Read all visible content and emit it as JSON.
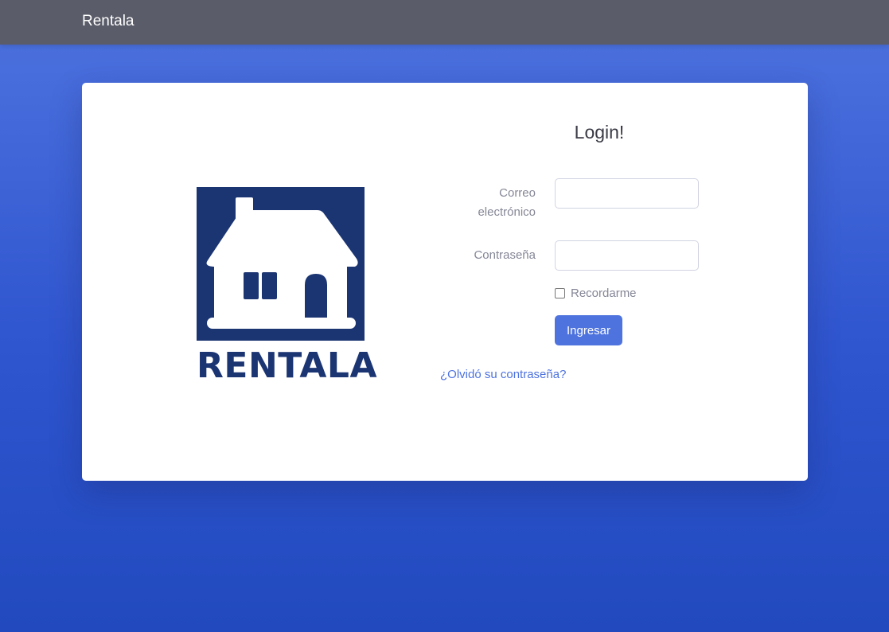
{
  "navbar": {
    "brand": "Rentala"
  },
  "logo": {
    "text": "RENTALA",
    "color": "#1b3573",
    "icon": "house-icon"
  },
  "form": {
    "title": "Login!",
    "email_label": "Correo electrónico",
    "email_value": "",
    "password_label": "Contraseña",
    "password_value": "",
    "remember_label": "Recordarme",
    "remember_checked": false,
    "submit_label": "Ingresar",
    "forgot_link": "¿Olvidó su contraseña?"
  },
  "colors": {
    "navbar": "#5a5c69",
    "primary": "#4e73df",
    "background_top": "#4e73df",
    "background_bottom": "#224abe",
    "label": "#858796"
  }
}
